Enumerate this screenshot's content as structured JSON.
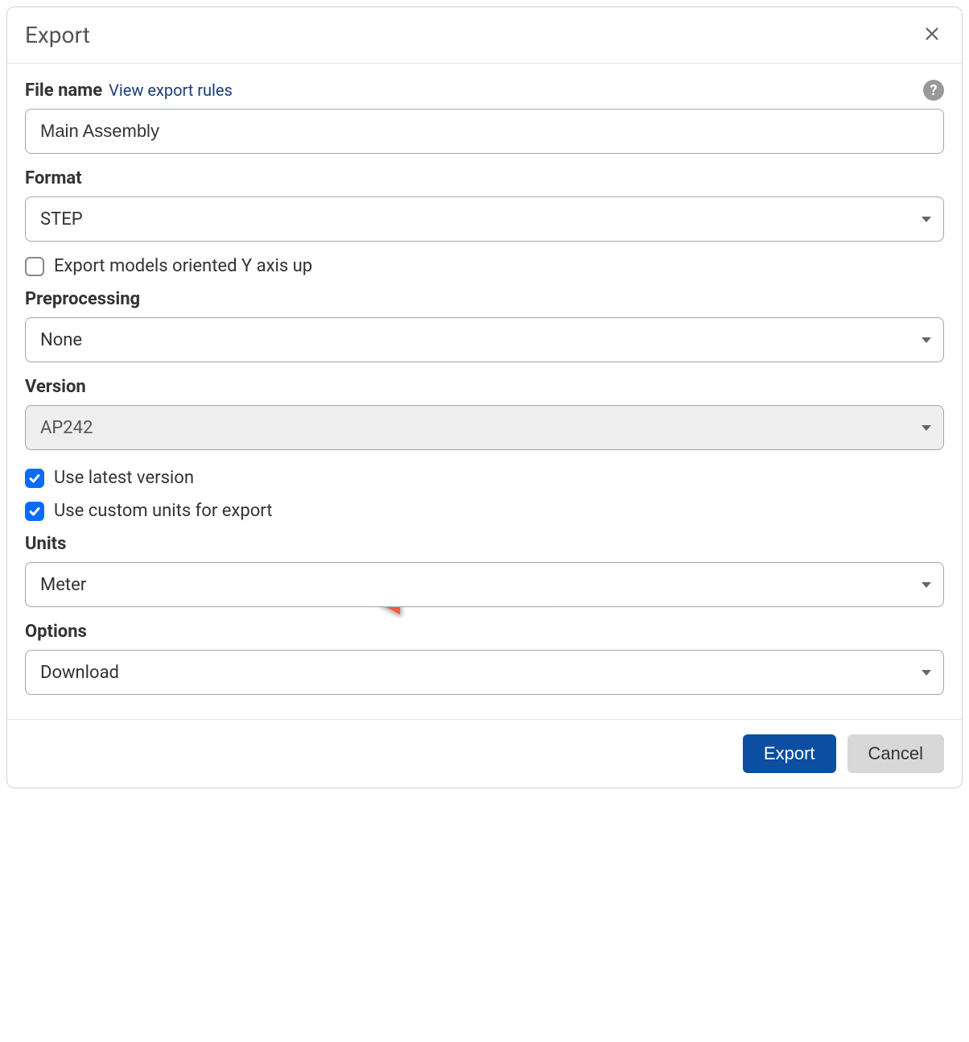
{
  "dialog": {
    "title": "Export"
  },
  "file_name": {
    "label": "File name",
    "link_text": "View export rules",
    "value": "Main Assembly"
  },
  "format": {
    "label": "Format",
    "value": "STEP"
  },
  "y_axis_up": {
    "label": "Export models oriented Y axis up",
    "checked": false
  },
  "preprocessing": {
    "label": "Preprocessing",
    "value": "None"
  },
  "version": {
    "label": "Version",
    "value": "AP242"
  },
  "use_latest": {
    "label": "Use latest version",
    "checked": true
  },
  "use_custom_units": {
    "label": "Use custom units for export",
    "checked": true
  },
  "units": {
    "label": "Units",
    "value": "Meter"
  },
  "options": {
    "label": "Options",
    "value": "Download"
  },
  "footer": {
    "export_label": "Export",
    "cancel_label": "Cancel"
  },
  "help_icon_symbol": "?",
  "annotation": {
    "arrow_color": "#f55a42"
  }
}
